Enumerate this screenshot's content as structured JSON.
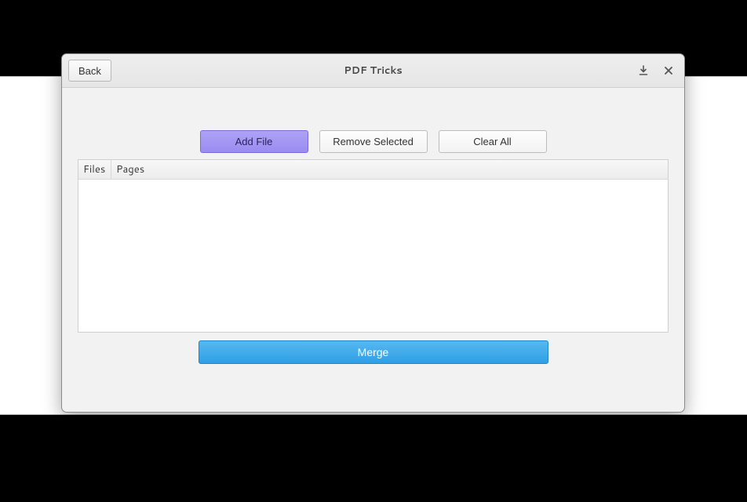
{
  "header": {
    "title": "PDF Tricks",
    "back_label": "Back"
  },
  "toolbar": {
    "add_file": "Add File",
    "remove_selected": "Remove Selected",
    "clear_all": "Clear All"
  },
  "columns": {
    "files": "Files",
    "pages": "Pages"
  },
  "actions": {
    "merge": "Merge"
  }
}
